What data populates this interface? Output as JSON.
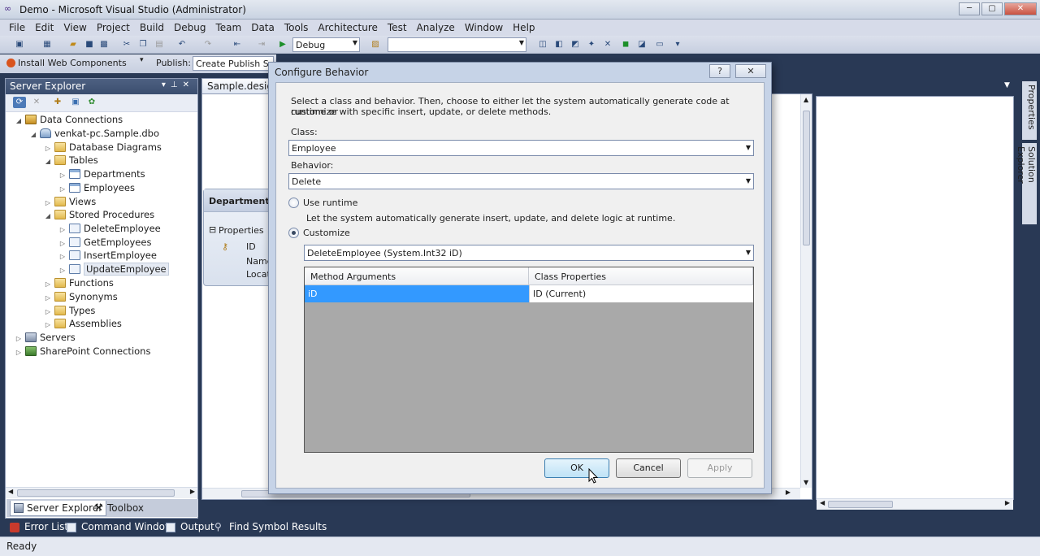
{
  "window": {
    "title": "Demo - Microsoft Visual Studio (Administrator)",
    "buttons": [
      "─",
      "▢",
      "✕"
    ]
  },
  "menu": [
    "File",
    "Edit",
    "View",
    "Project",
    "Build",
    "Debug",
    "Team",
    "Data",
    "Tools",
    "Architecture",
    "Test",
    "Analyze",
    "Window",
    "Help"
  ],
  "toolbar": {
    "config": "Debug",
    "search_value": ""
  },
  "toolbar2": {
    "install": "Install Web Components",
    "publish_label": "Publish:",
    "publish_value": "Create Publish Sett"
  },
  "server_explorer": {
    "title": "Server Explorer",
    "tree": {
      "data_connections": "Data Connections",
      "connection": "venkat-pc.Sample.dbo",
      "database_diagrams": "Database Diagrams",
      "tables": "Tables",
      "departments": "Departments",
      "employees": "Employees",
      "views": "Views",
      "stored_procedures": "Stored Procedures",
      "delete_employee": "DeleteEmployee",
      "get_employees": "GetEmployees",
      "insert_employee": "InsertEmployee",
      "update_employee": "UpdateEmployee",
      "functions": "Functions",
      "synonyms": "Synonyms",
      "types": "Types",
      "assemblies": "Assemblies",
      "servers": "Servers",
      "sharepoint": "SharePoint Connections"
    }
  },
  "bottom_tabs": {
    "server_explorer": "Server Explorer",
    "toolbox": "Toolbox"
  },
  "designer": {
    "tab": "Sample.designe",
    "entity": {
      "name": "Department",
      "section": "Properties",
      "props": [
        "ID",
        "Name",
        "Locat"
      ]
    }
  },
  "right_tabs": {
    "properties": "Properties",
    "solution_explorer": "Solution Explorer"
  },
  "output_tabs": {
    "error_list": "Error List",
    "command_window": "Command Window",
    "output": "Output",
    "find_symbol": "Find Symbol Results"
  },
  "status": "Ready",
  "dialog": {
    "title": "Configure Behavior",
    "help_btn": "?",
    "close_btn": "✕",
    "intro_line1": "Select a class and behavior.  Then, choose to either let the system automatically generate code at runtime or",
    "intro_line2": "customize with specific insert, update, or delete methods.",
    "class_label": "Class:",
    "class_value": "Employee",
    "behavior_label": "Behavior:",
    "behavior_value": "Delete",
    "use_runtime": "Use runtime",
    "runtime_desc": "Let the system automatically generate insert, update, and delete logic at runtime.",
    "customize": "Customize",
    "method_value": "DeleteEmployee (System.Int32 iD)",
    "grid": {
      "col1": "Method Arguments",
      "col2": "Class Properties",
      "row1_arg": "iD",
      "row1_prop": "ID (Current)"
    },
    "ok": "OK",
    "cancel": "Cancel",
    "apply": "Apply"
  }
}
